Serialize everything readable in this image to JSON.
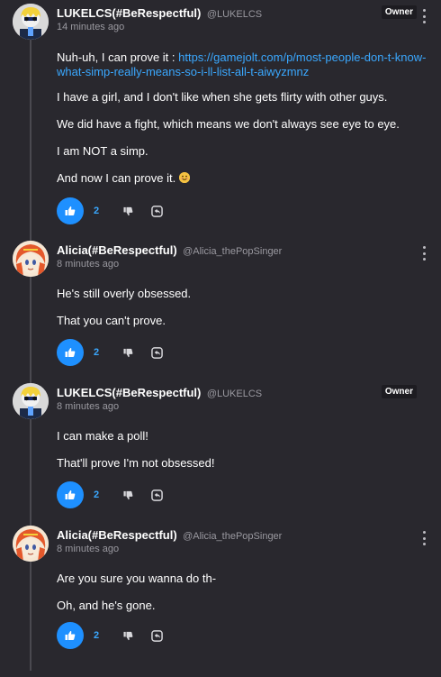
{
  "colors": {
    "background": "#29282e",
    "link": "#3aa8ff",
    "like_button": "#1e90ff",
    "muted_text": "#9a99a0"
  },
  "comments": [
    {
      "display_name": "LUKELCS(#BeRespectful)",
      "username": "@LUKELCS",
      "time": "14 minutes ago",
      "badge": "Owner",
      "avatar_icon": "luke-avatar-icon",
      "paragraph_1_text": "Nuh-uh, I can prove it : ",
      "paragraph_1_link": "https://gamejolt.com/p/most-people-don-t-know-what-simp-really-means-so-i-ll-list-all-t-aiwyzmnz",
      "paragraph_2": "I have a girl, and I don't like when she gets flirty with other guys.",
      "paragraph_3": "We did have a fight, which means we don't always see eye to eye.",
      "paragraph_4": "I am NOT a simp.",
      "paragraph_5": "And now I can prove it. ",
      "likes": "2"
    },
    {
      "display_name": "Alicia(#BeRespectful)",
      "username": "@Alicia_thePopSinger",
      "time": "8 minutes ago",
      "avatar_icon": "alicia-avatar-icon",
      "paragraph_1": "He's still overly obsessed.",
      "paragraph_2": "That you can't prove.",
      "likes": "2"
    },
    {
      "display_name": "LUKELCS(#BeRespectful)",
      "username": "@LUKELCS",
      "time": "8 minutes ago",
      "badge": "Owner",
      "avatar_icon": "luke-avatar-icon",
      "paragraph_1": "I can make a poll!",
      "paragraph_2": "That'll prove I'm not obsessed!",
      "likes": "2"
    },
    {
      "display_name": "Alicia(#BeRespectful)",
      "username": "@Alicia_thePopSinger",
      "time": "8 minutes ago",
      "avatar_icon": "alicia-avatar-icon",
      "paragraph_1": "Are you sure you wanna do th-",
      "paragraph_2": "Oh, and he's gone.",
      "likes": "2"
    }
  ]
}
